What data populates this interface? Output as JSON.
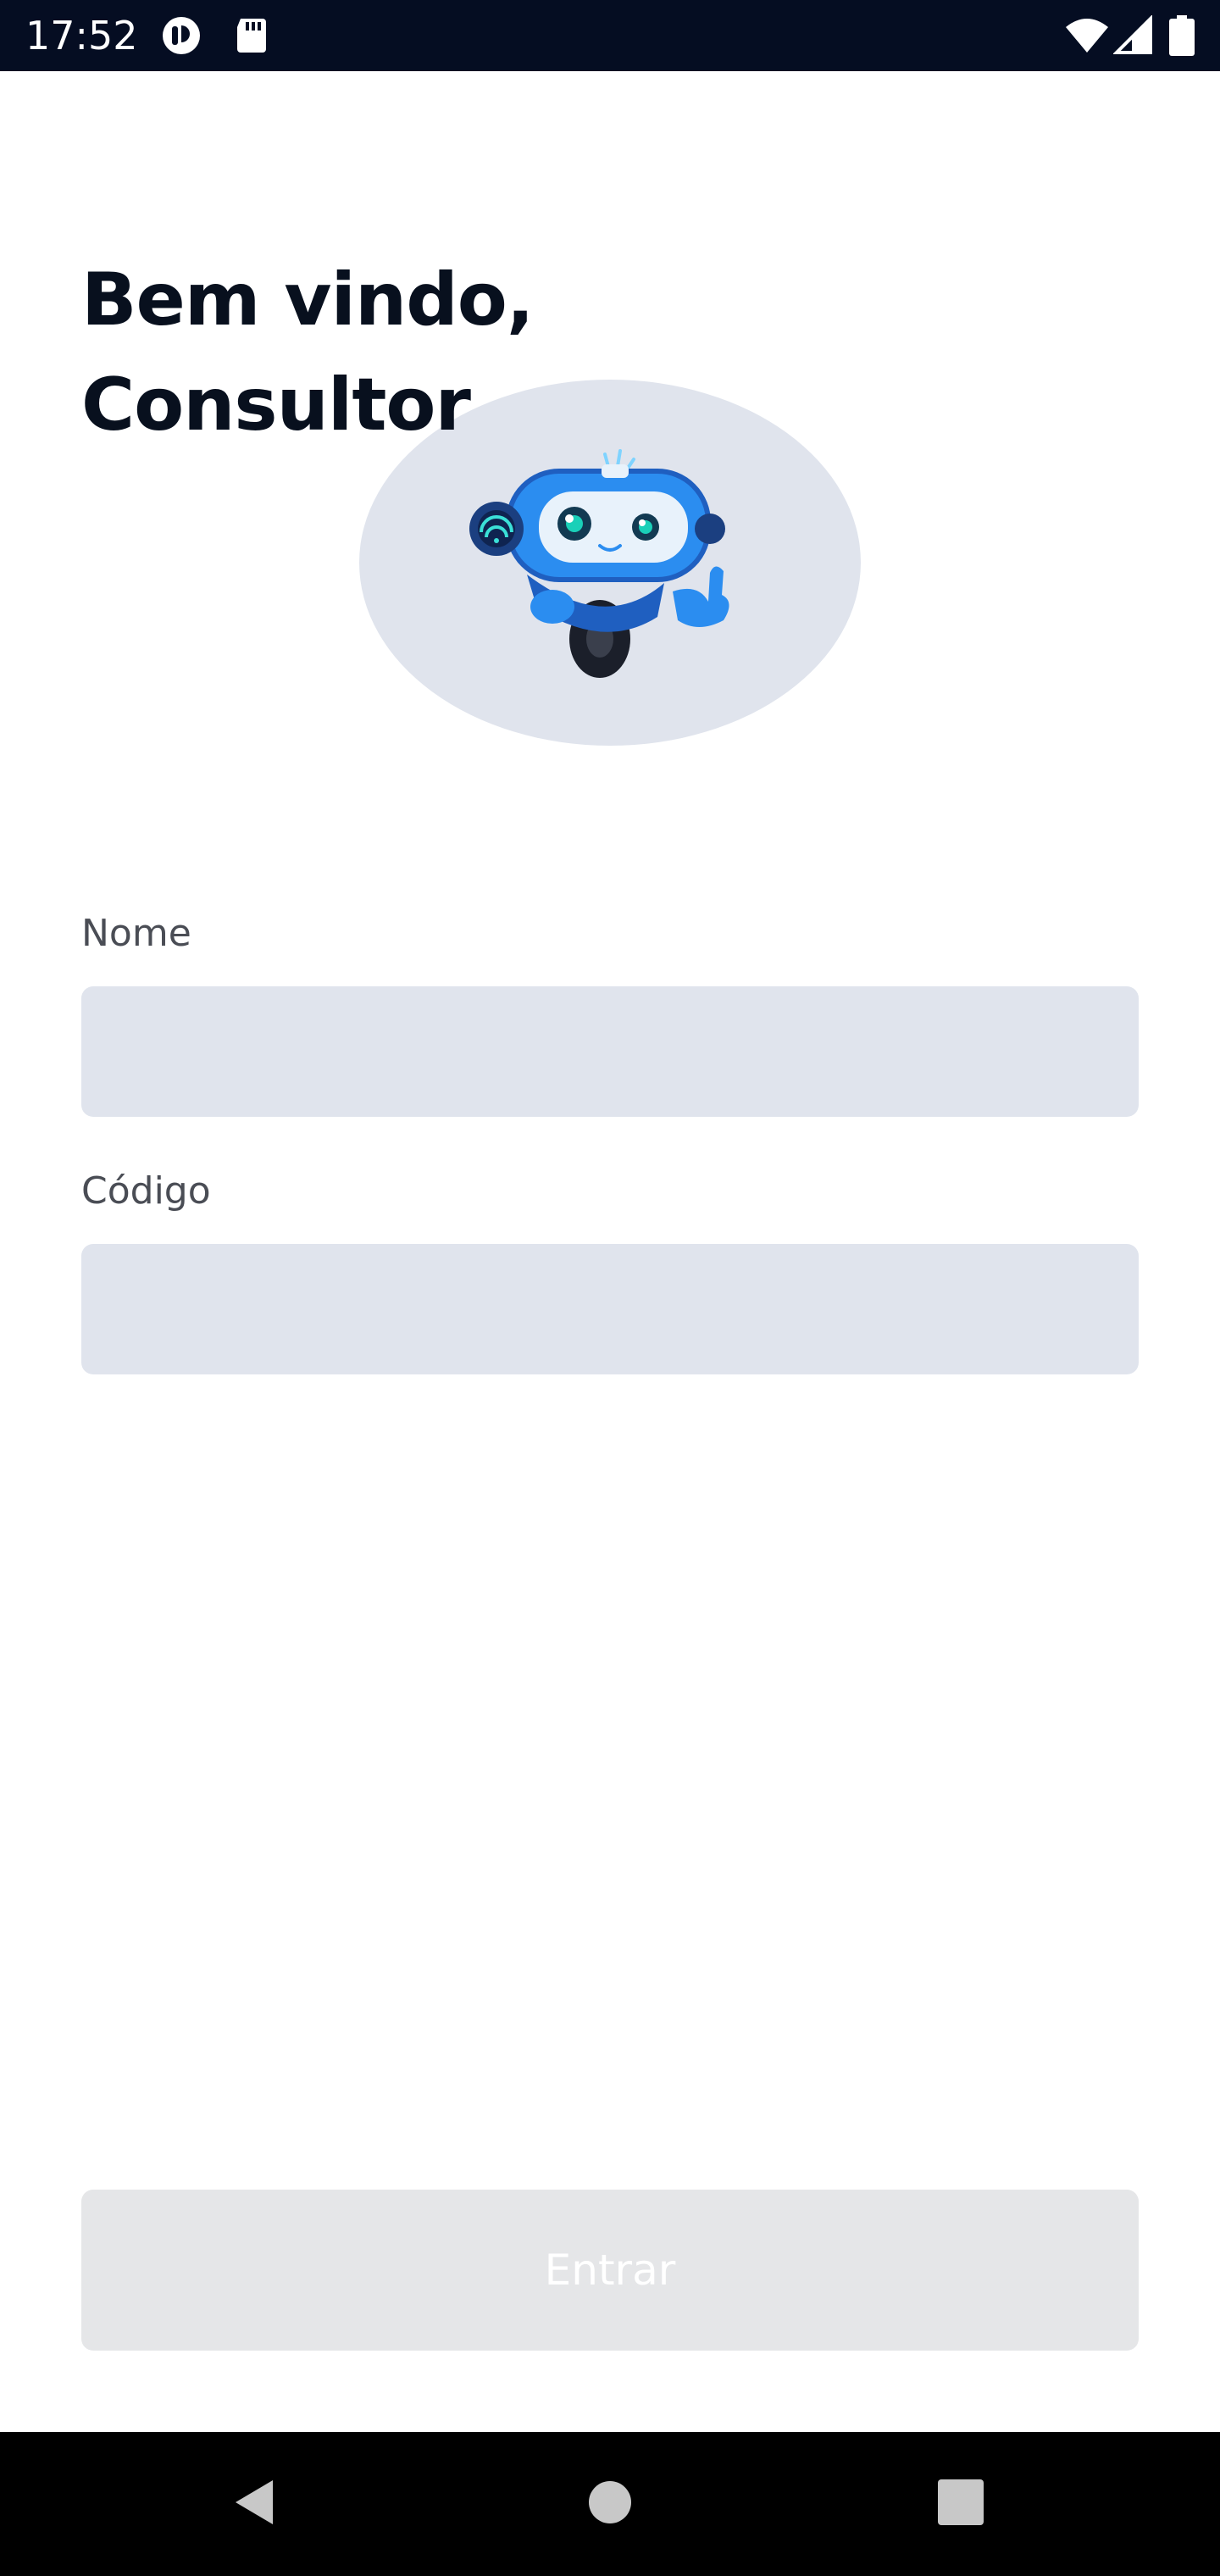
{
  "status_bar": {
    "time": "17:52",
    "left_icons": [
      "app-notification-icon",
      "sd-card-icon"
    ],
    "right_icons": [
      "wifi-icon",
      "cell-signal-icon",
      "battery-icon"
    ]
  },
  "header": {
    "title_line1": "Bem vindo,",
    "title_line2": "Consultor"
  },
  "mascot": {
    "icon": "robot-mascot-thumbs-up"
  },
  "form": {
    "name_label": "Nome",
    "name_value": "",
    "code_label": "Código",
    "code_value": ""
  },
  "actions": {
    "submit_label": "Entrar",
    "submit_enabled": false
  },
  "nav_bar": {
    "icons": [
      "back-icon",
      "home-icon",
      "recents-icon"
    ]
  },
  "colors": {
    "status_bar_bg": "#050d22",
    "title": "#08101e",
    "input_bg": "#e0e4ed",
    "button_disabled_bg": "#e5e6e8",
    "accent_blue": "#2b8df0",
    "nav_bar_bg": "#000000"
  }
}
